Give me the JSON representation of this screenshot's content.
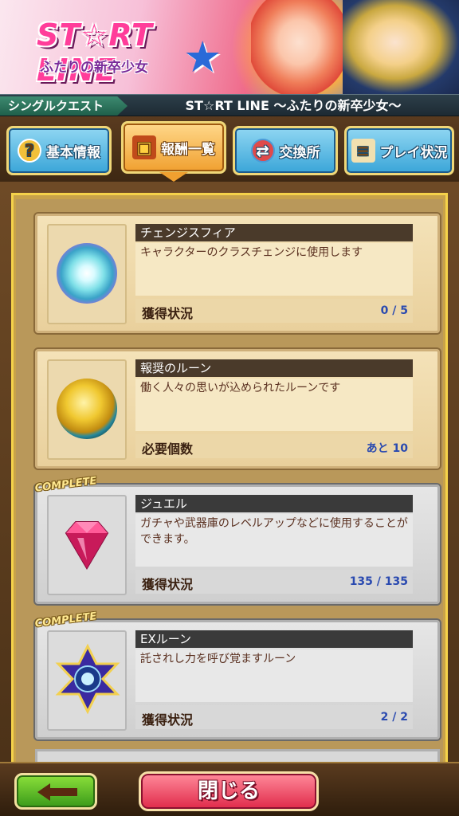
{
  "banner": {
    "logo_title": "ST☆RT LINE",
    "logo_subtitle": "ふたりの新卒少女"
  },
  "titlebar": {
    "category": "シングルクエスト",
    "quest_name": "ST☆RT LINE 〜ふたりの新卒少女〜"
  },
  "tabs": [
    {
      "label": "基本情報",
      "icon": "question-icon",
      "active": false
    },
    {
      "label": "報酬一覧",
      "icon": "treasure-chest-icon",
      "active": true
    },
    {
      "label": "交換所",
      "icon": "exchange-icon",
      "active": false
    },
    {
      "label": "プレイ状況",
      "icon": "scroll-icon",
      "active": false
    }
  ],
  "rewards": [
    {
      "name": "チェンジスフィア",
      "description": "キャラクターのクラスチェンジに使用します",
      "status_label": "獲得状況",
      "status_value": "0 / 5",
      "complete": false,
      "icon": "sphere-icon"
    },
    {
      "name": "報奨のルーン",
      "description": "働く人々の思いが込められたルーンです",
      "status_label": "必要個数",
      "status_value": "あと 10",
      "complete": false,
      "icon": "rune-coin-icon"
    },
    {
      "name": "ジュエル",
      "description": "ガチャや武器庫のレベルアップなどに使用することができます。",
      "status_label": "獲得状況",
      "status_value": "135 / 135",
      "complete": true,
      "icon": "jewel-icon"
    },
    {
      "name": "EXルーン",
      "description": "託されし力を呼び覚ますルーン",
      "status_label": "獲得状況",
      "status_value": "2 / 2",
      "complete": true,
      "icon": "ex-rune-icon"
    }
  ],
  "complete_badge": "COMPLETE",
  "footer": {
    "close_label": "閉じる"
  },
  "colors": {
    "accent_gold": "#f5d24a",
    "status_value_blue": "#2a4ab0",
    "close_button": "#e02a4a",
    "back_button": "#3a9a1a"
  }
}
